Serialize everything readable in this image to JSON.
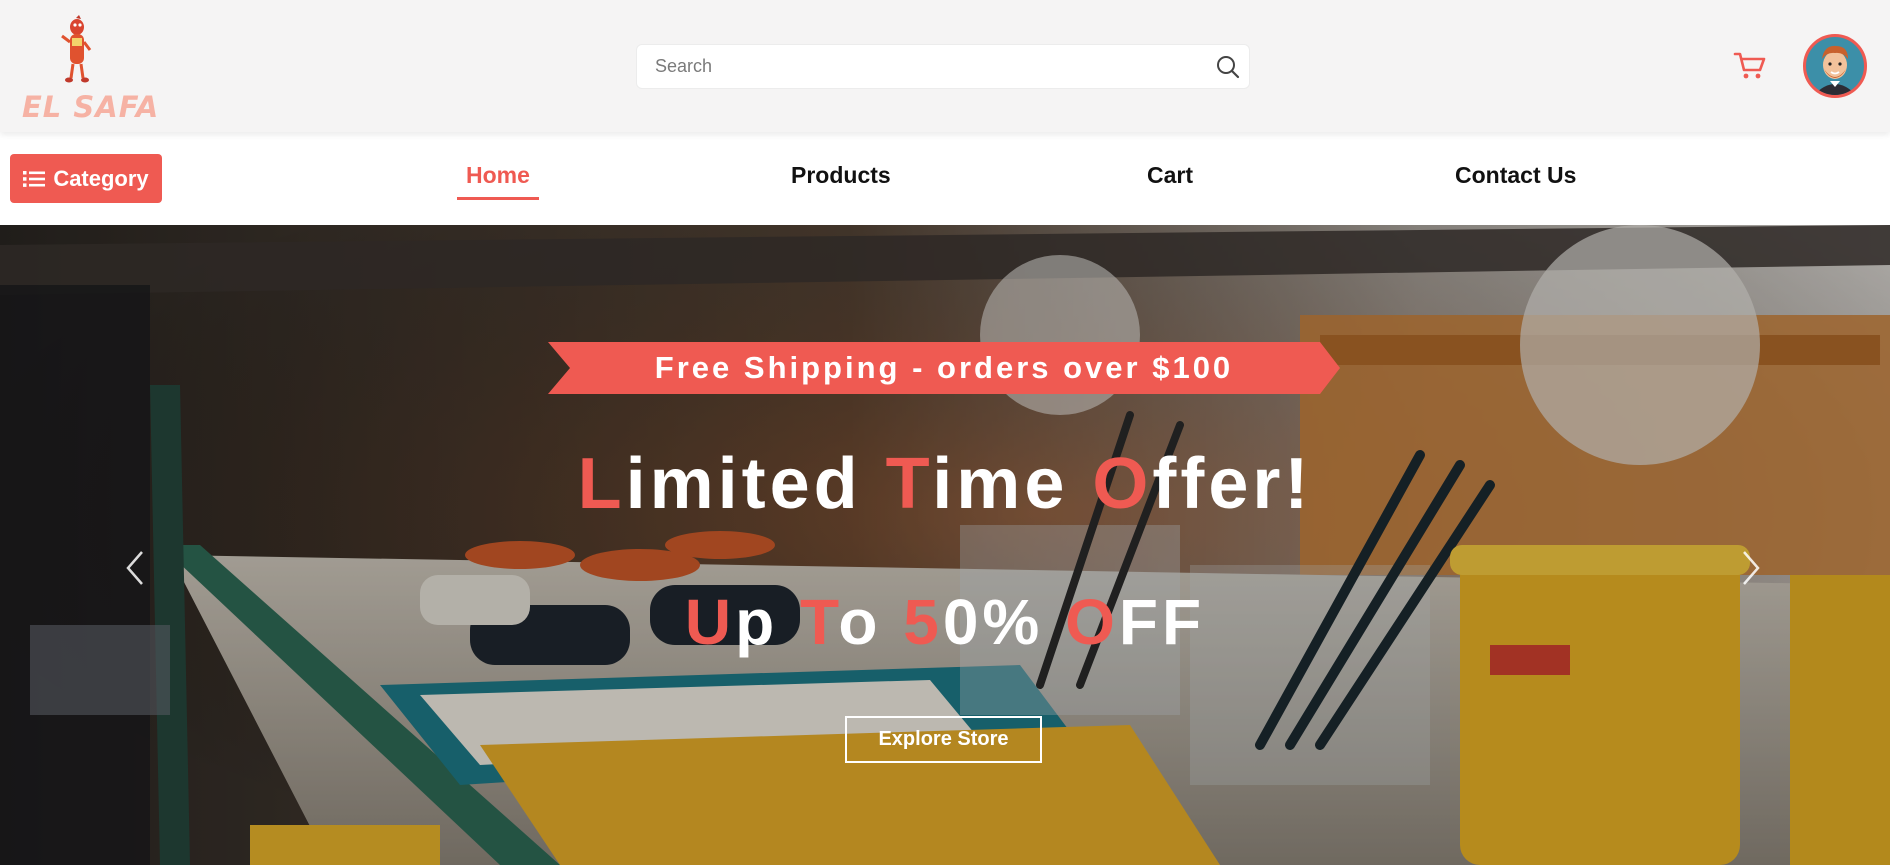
{
  "header": {
    "logo_text": "EL SAFA",
    "search": {
      "placeholder": "Search",
      "value": ""
    },
    "icons": {
      "search": "search-icon",
      "cart": "cart-icon",
      "avatar": "user-avatar"
    }
  },
  "nav": {
    "category_label": "Category",
    "links": [
      {
        "label": "Home",
        "active": true
      },
      {
        "label": "Products",
        "active": false
      },
      {
        "label": "Cart",
        "active": false
      },
      {
        "label": "Contact Us",
        "active": false
      }
    ]
  },
  "hero": {
    "ribbon_text": "Free Shipping - orders over $100",
    "headline": "Limited Time Offer!",
    "subline": "Up To 50% OFF",
    "cta_label": "Explore Store",
    "icons": {
      "prev": "chevron-left-icon",
      "next": "chevron-right-icon"
    }
  },
  "colors": {
    "accent": "#ef5a52",
    "header_bg": "#f5f4f4",
    "logo_text": "#f6b2a4",
    "nav_text": "#111111"
  }
}
